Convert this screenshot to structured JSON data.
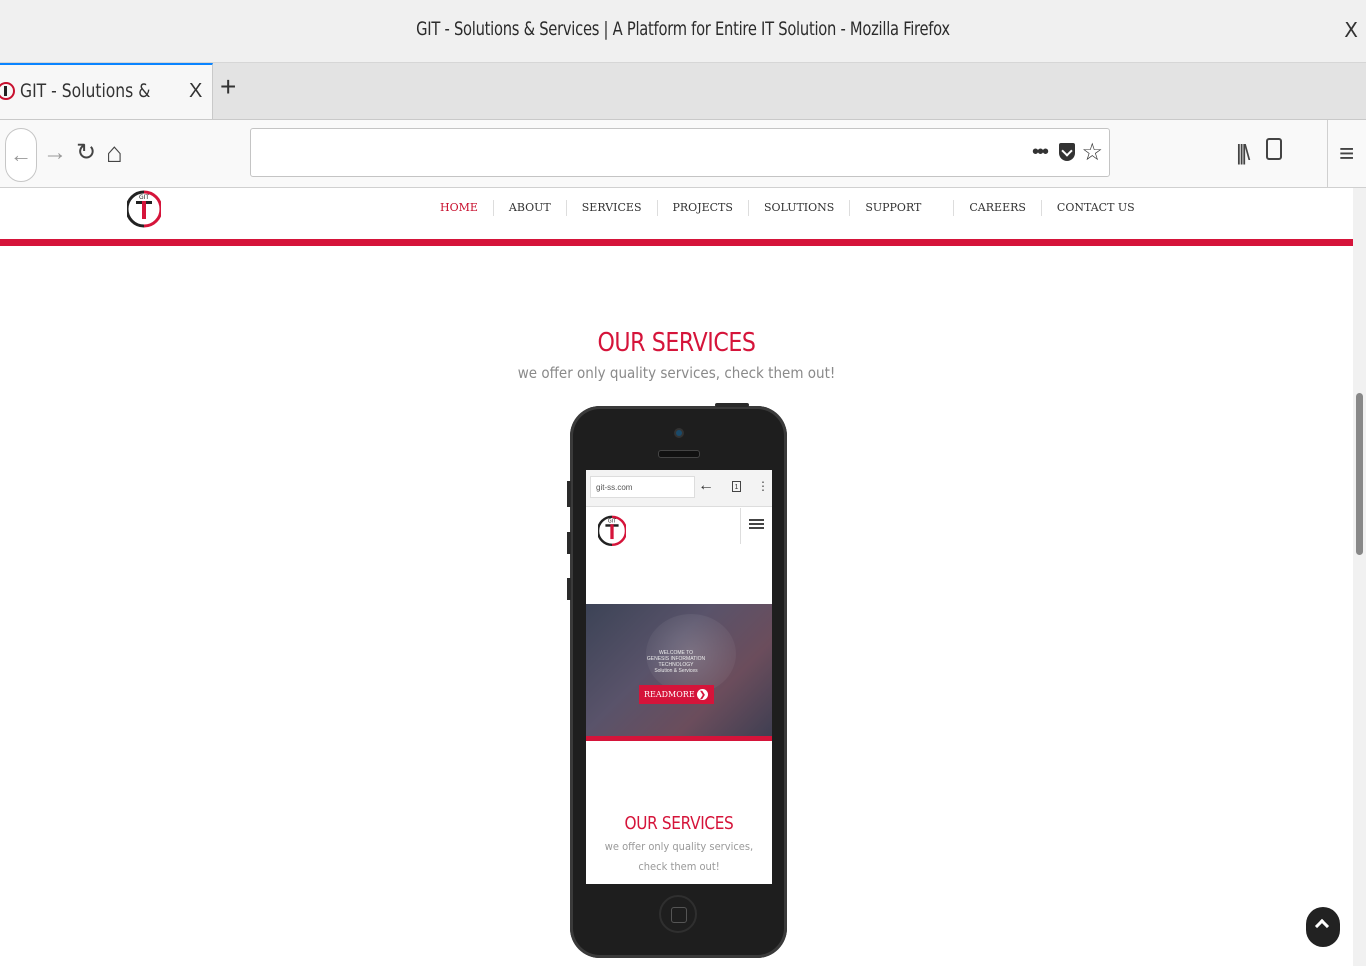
{
  "window": {
    "title": "GIT - Solutions & Services | A Platform for Entire IT Solution - Mozilla Firefox",
    "close_glyph": "X"
  },
  "tab": {
    "label": "GIT - Solutions & Services | A Platform for Entire IT Solution",
    "close_glyph": "X",
    "new_tab_glyph": "+"
  },
  "navbar": {
    "back_glyph": "←",
    "forward_glyph": "→",
    "reload_glyph": "↻",
    "home_glyph": "⌂",
    "url": "",
    "page_actions_glyph": "•••",
    "bookmark_glyph": "☆",
    "library_glyph": "|||\\",
    "sidebar_glyph": "▯",
    "menu_glyph": "≡"
  },
  "site": {
    "menu": [
      {
        "label": "HOME",
        "active": true
      },
      {
        "label": "ABOUT",
        "active": false
      },
      {
        "label": "SERVICES",
        "active": false
      },
      {
        "label": "PROJECTS",
        "active": false
      },
      {
        "label": "SOLUTIONS",
        "active": false
      },
      {
        "label": "SUPPORT",
        "active": false
      },
      {
        "label": "CAREERS",
        "active": false
      },
      {
        "label": "CONTACT US",
        "active": false
      }
    ],
    "logo_text": "GIT",
    "services_heading": "OUR SERVICES",
    "services_subtitle": "we offer only quality services, check them out!",
    "accent_color": "#d5143a"
  },
  "phone_screen": {
    "url": "git-ss.com",
    "tabs_count": "1",
    "more_glyph": "⋮",
    "hero_lines": [
      "WELCOME TO",
      "GENESIS INFORMATION",
      "TECHNOLOGY",
      "Solution & Services"
    ],
    "readmore_label": "READMORE",
    "readmore_icon": "❯",
    "heading": "OUR SERVICES",
    "subtitle": "we offer only quality services, check them out!"
  },
  "back_to_top_icon": "chevron-up-icon"
}
